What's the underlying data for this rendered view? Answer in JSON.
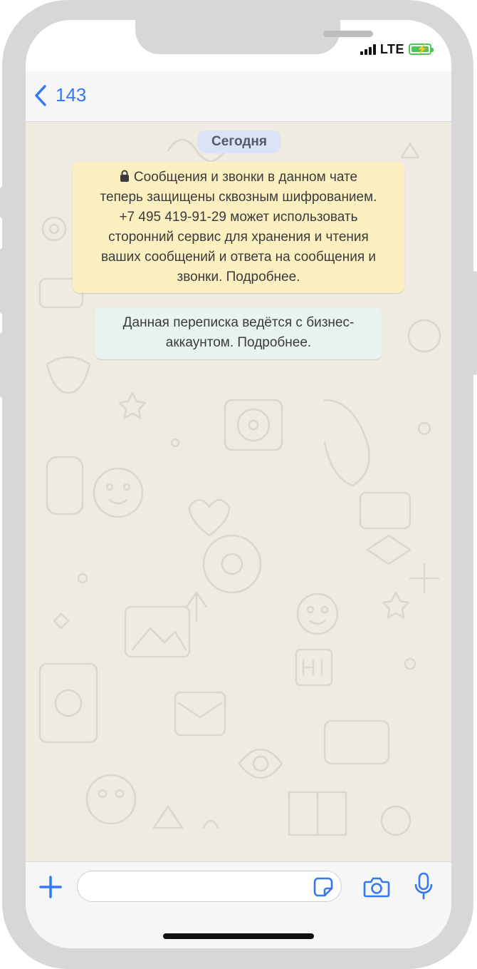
{
  "status_bar": {
    "network": "LTE",
    "signal_bars": 4,
    "battery_charging": true
  },
  "header": {
    "back_label": "143"
  },
  "chat": {
    "date_label": "Сегодня",
    "encryption_notice_lines": [
      "Сообщения и звонки в данном чате",
      "теперь защищены сквозным шифрованием.",
      "+7 495 419-91-29 может использовать",
      "сторонний сервис для хранения и чтения",
      "ваших сообщений и ответа на сообщения и",
      "звонки. Подробнее."
    ],
    "business_notice_lines": [
      "Данная переписка ведётся с бизнес-",
      "аккаунтом. Подробнее."
    ]
  },
  "input": {
    "text": "",
    "placeholder": ""
  },
  "icons": {
    "back": "chevron-left-icon",
    "lock": "lock-icon",
    "add": "plus-icon",
    "sticker": "sticker-icon",
    "camera": "camera-icon",
    "microphone": "microphone-icon"
  },
  "colors": {
    "accent": "#3478f6",
    "chat_background": "#efeae2",
    "encryption_bubble": "#fcf0c1",
    "business_bubble": "#e9f3ef",
    "date_pill": "#dde3f6",
    "battery": "#4fc45a"
  }
}
